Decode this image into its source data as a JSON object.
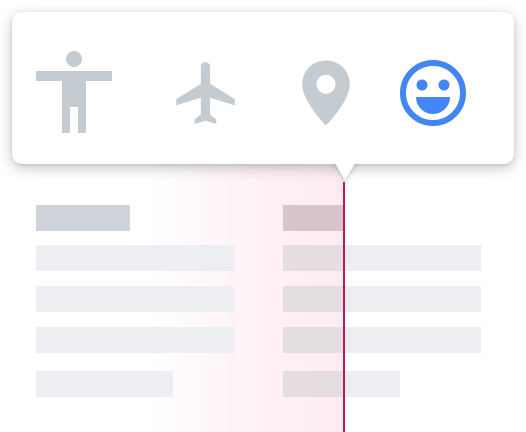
{
  "toolbar": {
    "items": [
      {
        "icon": "accessibility-icon",
        "label": "",
        "selected": false,
        "color": "#c4cbd1"
      },
      {
        "icon": "airplane-icon",
        "label": "",
        "selected": false,
        "color": "#c4cbd1"
      },
      {
        "icon": "location-pin-icon",
        "label": "",
        "selected": false,
        "color": "#c4cbd1"
      },
      {
        "icon": "smiley-face-icon",
        "label": "",
        "selected": true,
        "color": "#4285f4"
      }
    ]
  },
  "colors": {
    "inactive_icon": "#c4cbd1",
    "active_icon": "#4285f4",
    "cursor": "#c2185b",
    "highlight": "#e91e63"
  }
}
